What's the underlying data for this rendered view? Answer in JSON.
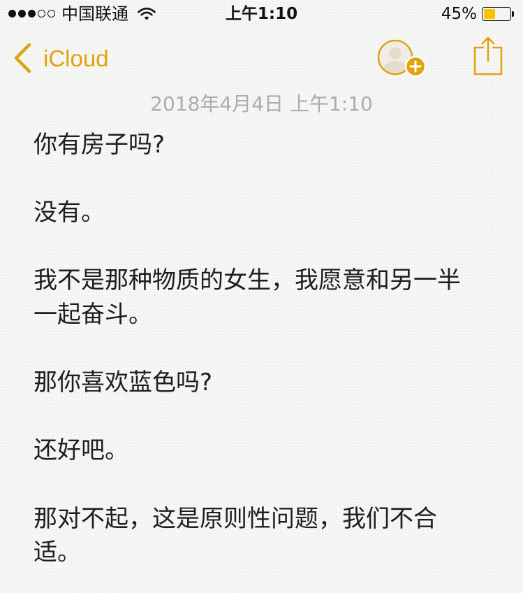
{
  "status_bar": {
    "signal_level": 3,
    "signal_max": 5,
    "carrier": "中国联通",
    "wifi_icon": "wifi-icon",
    "time": "上午1:10",
    "battery_label": "45%",
    "battery_level": 0.45,
    "battery_icon": "battery-icon",
    "battery_fill_color": "#F6C400"
  },
  "nav_bar": {
    "back_icon": "chevron-left-icon",
    "back_label": "iCloud",
    "add_person_icon": "person-add-icon",
    "share_icon": "share-icon",
    "accent_color": "#E0A30F"
  },
  "note": {
    "date": "2018年4月4日 上午1:10",
    "paragraphs": [
      {
        "lines": [
          "你有房子吗?"
        ]
      },
      {
        "lines": [
          "没有。"
        ]
      },
      {
        "lines": [
          "我不是那种物质的女生，我愿意和另一半",
          "一起奋斗。"
        ]
      },
      {
        "lines": [
          "那你喜欢蓝色吗?"
        ]
      },
      {
        "lines": [
          "还好吧。"
        ]
      },
      {
        "lines": [
          "那对不起，这是原则性问题，我们不合",
          "适。"
        ]
      }
    ]
  }
}
